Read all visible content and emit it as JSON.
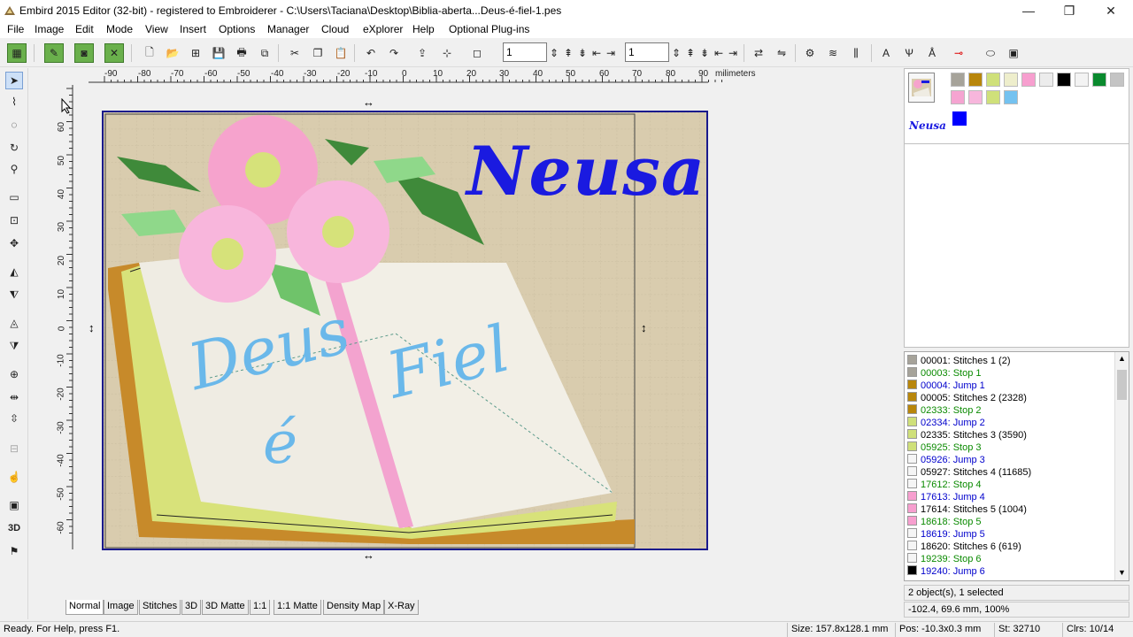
{
  "window": {
    "title": "Embird 2015 Editor (32-bit) - registered to Embroiderer - C:\\Users\\Taciana\\Desktop\\Biblia-aberta...Deus-é-fiel-1.pes",
    "minimize": "—",
    "maximize": "❐",
    "close": "✕"
  },
  "menu": [
    "File",
    "Image",
    "Edit",
    "Mode",
    "View",
    "Insert",
    "Options",
    "Manager",
    "Cloud",
    "eXplorer",
    "Help",
    "Optional Plug-ins"
  ],
  "toolbar": {
    "field1_value": "1",
    "field2_value": "1"
  },
  "ruler": {
    "unit": "milimeters",
    "h_ticks": [
      "-90",
      "-80",
      "-70",
      "-60",
      "-50",
      "-40",
      "-30",
      "-20",
      "-10",
      "0",
      "10",
      "20",
      "30",
      "40",
      "50",
      "60",
      "70",
      "80",
      "90"
    ],
    "v_ticks": [
      "60",
      "50",
      "40",
      "30",
      "20",
      "10",
      "0",
      "-10",
      "-20",
      "-30",
      "-40",
      "-50",
      "-60"
    ]
  },
  "design": {
    "name_text": "Neusa",
    "left_page_text": "Deus",
    "middle_text": "é",
    "right_page_text": "Fiel"
  },
  "palette": {
    "swatches": [
      "#a6a39a",
      "#b8860b",
      "#cfe07a",
      "#eeeecc",
      "#f79fcf",
      "#ececec",
      "#000000",
      "#f3f3f3",
      "#0a8a2e",
      "#c4c4c4",
      "#f5a4d1",
      "#f7b6dc",
      "#cfe07a",
      "#74c2f0"
    ],
    "object_label": "Neusa",
    "object_color": "#0000ff"
  },
  "stitch_list": [
    {
      "code": "00001:",
      "text": "Stitches 1 (2)",
      "kind": "stitch",
      "color": "#a6a39a"
    },
    {
      "code": "00003:",
      "text": "Stop 1",
      "kind": "stop",
      "color": "#a6a39a"
    },
    {
      "code": "00004:",
      "text": "Jump 1",
      "kind": "jump",
      "color": "#b8860b"
    },
    {
      "code": "00005:",
      "text": "Stitches 2 (2328)",
      "kind": "stitch",
      "color": "#b8860b"
    },
    {
      "code": "02333:",
      "text": "Stop 2",
      "kind": "stop",
      "color": "#b8860b"
    },
    {
      "code": "02334:",
      "text": "Jump 2",
      "kind": "jump",
      "color": "#cfe07a"
    },
    {
      "code": "02335:",
      "text": "Stitches 3 (3590)",
      "kind": "stitch",
      "color": "#cfe07a"
    },
    {
      "code": "05925:",
      "text": "Stop 3",
      "kind": "stop",
      "color": "#cfe07a"
    },
    {
      "code": "05926:",
      "text": "Jump 3",
      "kind": "jump",
      "color": "#f5f5f5"
    },
    {
      "code": "05927:",
      "text": "Stitches 4 (11685)",
      "kind": "stitch",
      "color": "#f5f5f5"
    },
    {
      "code": "17612:",
      "text": "Stop 4",
      "kind": "stop",
      "color": "#f5f5f5"
    },
    {
      "code": "17613:",
      "text": "Jump 4",
      "kind": "jump",
      "color": "#f79fcf"
    },
    {
      "code": "17614:",
      "text": "Stitches 5 (1004)",
      "kind": "stitch",
      "color": "#f79fcf"
    },
    {
      "code": "18618:",
      "text": "Stop 5",
      "kind": "stop",
      "color": "#f79fcf"
    },
    {
      "code": "18619:",
      "text": "Jump 5",
      "kind": "jump",
      "color": "#f5f5f5"
    },
    {
      "code": "18620:",
      "text": "Stitches 6 (619)",
      "kind": "stitch",
      "color": "#f5f5f5"
    },
    {
      "code": "19239:",
      "text": "Stop 6",
      "kind": "stop",
      "color": "#f5f5f5"
    },
    {
      "code": "19240:",
      "text": "Jump 6",
      "kind": "jump",
      "color": "#000000"
    }
  ],
  "selection_info": "2 object(s), 1 selected",
  "cursor_info": "-102.4, 69.6 mm, 100%",
  "tabs": [
    "Normal",
    "Image",
    "Stitches",
    "3D",
    "3D Matte",
    "1:1",
    "1:1 Matte",
    "Density Map",
    "X-Ray"
  ],
  "status": {
    "help": "Ready. For Help, press F1.",
    "size": "Size: 157.8x128.1 mm",
    "pos": "Pos: -10.3x0.3 mm",
    "stitches": "St: 32710",
    "colors": "Clrs: 10/14"
  },
  "colors": {
    "selection_border": "#1a1a8c",
    "fabric": "#d9ccae",
    "name_blue": "#1a1ae0",
    "text_light_blue": "#6ab8ea",
    "jump_blue": "#0000cc",
    "stop_green": "#0a8a00"
  }
}
